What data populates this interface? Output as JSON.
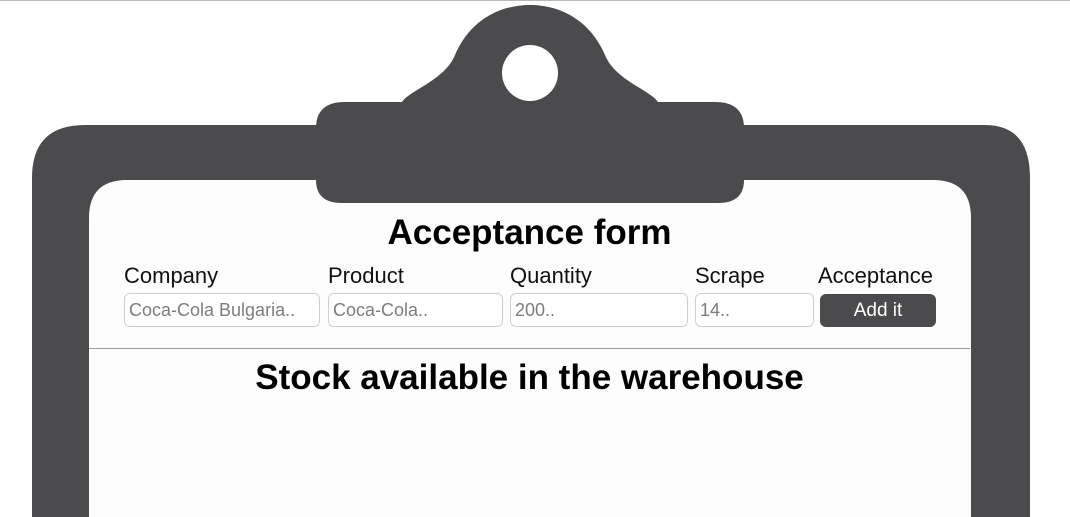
{
  "form": {
    "title": "Acceptance form",
    "fields": [
      {
        "label": "Company",
        "placeholder": "Coca-Cola Bulgaria.."
      },
      {
        "label": "Product",
        "placeholder": "Coca-Cola.."
      },
      {
        "label": "Quantity",
        "placeholder": "200.."
      },
      {
        "label": "Scrape",
        "placeholder": "14.."
      }
    ],
    "acceptance_label": "Acceptance",
    "add_button": "Add it"
  },
  "stock": {
    "title": "Stock available in the warehouse"
  },
  "colors": {
    "clipboard": "#4b4b4d",
    "paper": "#fdfdfd",
    "button": "#4b4b4d"
  }
}
